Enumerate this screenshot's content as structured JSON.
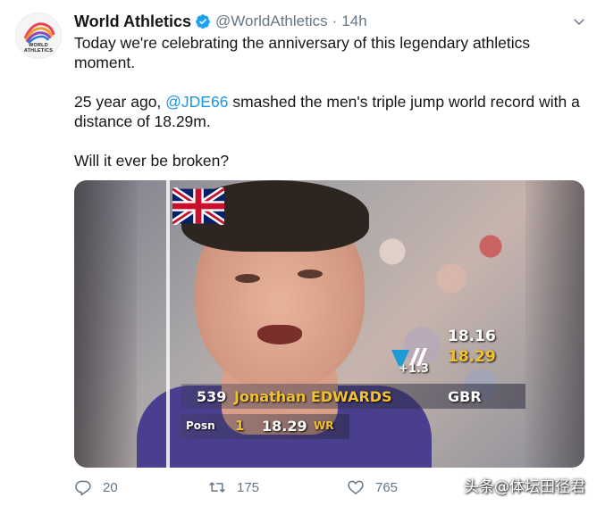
{
  "tweet": {
    "author_name": "World Athletics",
    "handle": "@WorldAthletics",
    "separator": "·",
    "time": "14h",
    "avatar_logo_text_1": "WORLD",
    "avatar_logo_text_2": "ATHLETICS",
    "text_line1": "Today we're celebrating the anniversary of this legendary athletics moment.",
    "text_p2_before": "25 year ago, ",
    "mention": "@JDE66",
    "text_p2_after": " smashed the men's triple jump world record with a distance of 18.29m.",
    "text_p3": "Will it ever be broken?"
  },
  "media_overlay": {
    "score_previous": "18.16",
    "score_current": "18.29",
    "wind": "+1.3",
    "bib_number": "539",
    "athlete_name": "Jonathan EDWARDS",
    "country": "GBR",
    "posn_label": "Posn",
    "posn_value": "1",
    "posn_mark": "18.29",
    "record_tag": "WR"
  },
  "actions": {
    "reply_count": "20",
    "retweet_count": "175",
    "like_count": "765"
  },
  "watermark": "头条@体坛田径君",
  "colors": {
    "link": "#1b95e0",
    "verified": "#1da1f2",
    "muted": "#657786",
    "overlay_yellow": "#f2c230"
  },
  "icons": [
    "verified-badge-icon",
    "chevron-down-icon",
    "reply-icon",
    "retweet-icon",
    "like-icon",
    "union-jack-flag-icon"
  ]
}
